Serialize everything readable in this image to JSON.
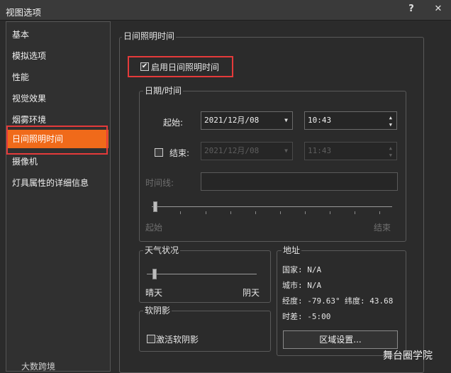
{
  "window": {
    "title": "视图选项",
    "help": "?",
    "close": "✕"
  },
  "sidebar": {
    "items": [
      {
        "label": "基本"
      },
      {
        "label": "模拟选项"
      },
      {
        "label": "性能"
      },
      {
        "label": "视觉效果"
      },
      {
        "label": "烟雾环境"
      },
      {
        "label": "日间照明时间",
        "active": true
      },
      {
        "label": "摄像机"
      },
      {
        "label": "灯具属性的详细信息"
      }
    ]
  },
  "panel": {
    "title": "日间照明时间",
    "enable_checkbox": {
      "label": "启用日间照明时间",
      "checked": true
    },
    "datetime": {
      "title": "日期/时间",
      "start": {
        "label": "起始:",
        "date": "2021/12月/08",
        "time": "10:43"
      },
      "end": {
        "label": "结束:",
        "date": "2021/12月/08",
        "time": "11:43",
        "checked": false
      },
      "timeline": {
        "label": "时间线:",
        "start_label": "起始",
        "end_label": "结束"
      }
    },
    "weather": {
      "title": "天气状况",
      "left": "晴天",
      "right": "阴天"
    },
    "soft_shadow": {
      "title": "软阴影",
      "checkbox_label": "激活软阴影",
      "checked": false
    },
    "address": {
      "title": "地址",
      "country": "国家: N/A",
      "city": "城市: N/A",
      "longitude": "经度: -79.63°",
      "latitude": "纬度: 43.68",
      "timezone": "时差: -5:00",
      "region_button": "区域设置..."
    }
  },
  "watermarks": {
    "left": "大数跨境",
    "right": "舞台圈学院"
  }
}
